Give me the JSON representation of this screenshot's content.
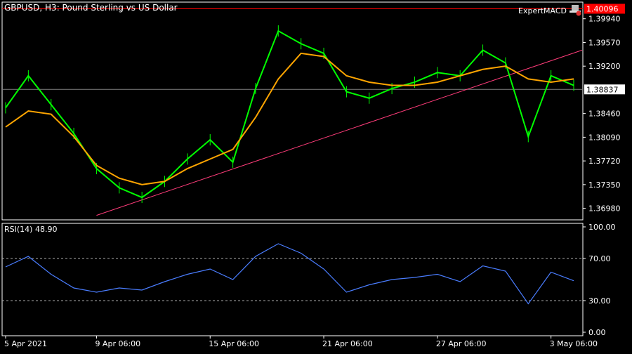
{
  "header": {
    "symbol_timeframe": "GBPUSD, H3:  Pound Sterling vs US Dollar",
    "expert_name": "ExpertMACD",
    "expert_icon": "hat-icon"
  },
  "colors": {
    "background": "#000000",
    "candle": "#00ff00",
    "moving_average": "#ffa500",
    "trendline": "#ff3c7a",
    "high_line": "#ff0000",
    "current_price_line": "#808080",
    "rsi_line": "#4a7dff",
    "axis_text": "#ffffff"
  },
  "price_axis": {
    "ticks": [
      "1.36980",
      "1.37350",
      "1.37720",
      "1.38090",
      "1.38460",
      "1.38837",
      "1.39200",
      "1.39570",
      "1.39940",
      "1.40096"
    ],
    "current_price_label": "1.38837",
    "high_line_label": "1.40096"
  },
  "time_axis": {
    "labels": [
      "5 Apr 2021",
      "9 Apr 06:00",
      "15 Apr 06:00",
      "21 Apr 06:00",
      "27 Apr 06:00",
      "3 May 06:00"
    ]
  },
  "rsi": {
    "label": "RSI(14) 48.90",
    "ticks": [
      "100.00",
      "70.00",
      "30.00",
      "0.00"
    ],
    "levels": [
      70,
      30
    ]
  },
  "chart_data": [
    {
      "type": "line",
      "panel": "price",
      "x": [
        "5 Apr 2021",
        "6 Apr",
        "7 Apr",
        "8 Apr",
        "9 Apr 06:00",
        "10 Apr",
        "12 Apr",
        "13 Apr",
        "14 Apr",
        "15 Apr 06:00",
        "16 Apr",
        "17 Apr",
        "19 Apr",
        "20 Apr",
        "21 Apr 06:00",
        "22 Apr",
        "23 Apr",
        "24 Apr",
        "26 Apr",
        "27 Apr 06:00",
        "28 Apr",
        "29 Apr",
        "30 Apr",
        "1 May",
        "3 May 06:00",
        "4 May"
      ],
      "series": [
        {
          "values": [
            1.3855,
            1.3905,
            1.386,
            1.3815,
            1.376,
            1.373,
            1.3715,
            1.374,
            1.3775,
            1.3805,
            1.377,
            1.3885,
            1.3975,
            1.3955,
            1.394,
            1.388,
            1.387,
            1.3885,
            1.3895,
            1.391,
            1.3905,
            1.3945,
            1.3925,
            1.381,
            1.3905,
            1.389
          ]
        },
        {
          "values": [
            1.3825,
            1.385,
            1.3845,
            1.381,
            1.3765,
            1.3745,
            1.3735,
            1.374,
            1.376,
            1.3775,
            1.379,
            1.384,
            1.39,
            1.394,
            1.3935,
            1.3905,
            1.3895,
            1.389,
            1.389,
            1.3895,
            1.3905,
            1.3915,
            1.392,
            1.39,
            1.3895,
            1.39
          ]
        }
      ],
      "trendline": {
        "from": [
          "9 Apr 06:00",
          1.3687
        ],
        "to": [
          "4 May",
          1.3945
        ]
      },
      "horizontal_lines": [
        1.40096,
        1.38837
      ],
      "ylim": [
        1.368,
        1.402
      ]
    },
    {
      "type": "line",
      "panel": "rsi",
      "title": "RSI(14) 48.90",
      "x": [
        "5 Apr 2021",
        "6 Apr",
        "7 Apr",
        "8 Apr",
        "9 Apr 06:00",
        "10 Apr",
        "12 Apr",
        "13 Apr",
        "14 Apr",
        "15 Apr 06:00",
        "16 Apr",
        "17 Apr",
        "19 Apr",
        "20 Apr",
        "21 Apr 06:00",
        "22 Apr",
        "23 Apr",
        "24 Apr",
        "26 Apr",
        "27 Apr 06:00",
        "28 Apr",
        "29 Apr",
        "30 Apr",
        "1 May",
        "3 May 06:00",
        "4 May"
      ],
      "series": [
        {
          "values": [
            62,
            72,
            55,
            42,
            38,
            42,
            40,
            48,
            55,
            60,
            50,
            72,
            84,
            75,
            60,
            38,
            45,
            50,
            52,
            55,
            48,
            63,
            58,
            27,
            57,
            48.9
          ]
        }
      ],
      "ylim": [
        0,
        100
      ]
    }
  ]
}
